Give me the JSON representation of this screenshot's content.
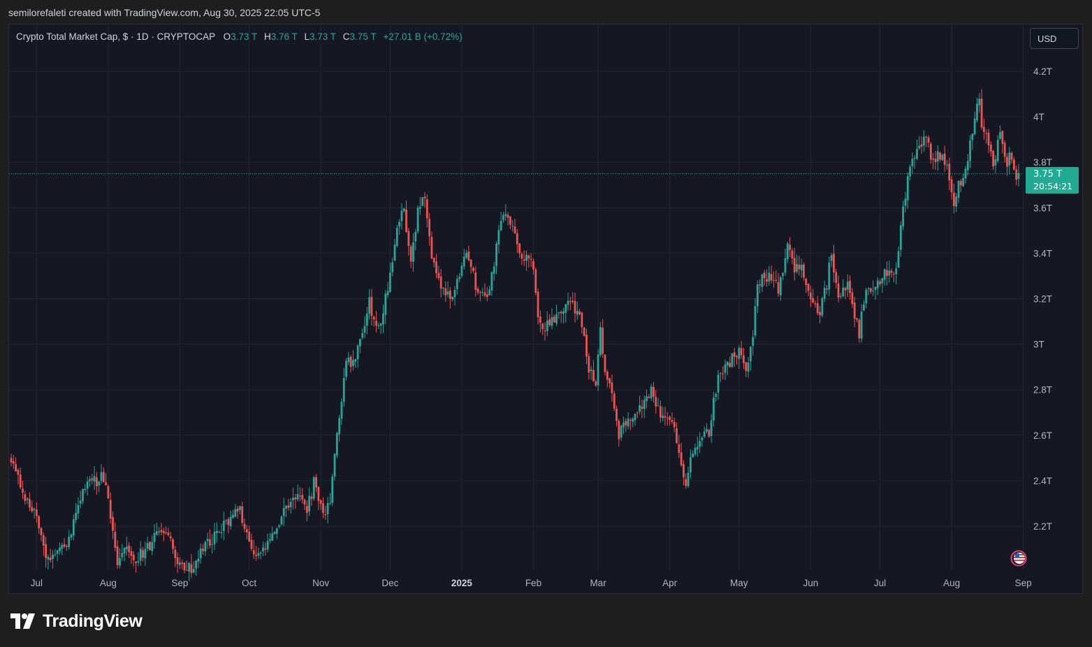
{
  "header": {
    "caption": "semilorefaleti created with TradingView.com, Aug 30, 2025 22:05 UTC-5"
  },
  "legend": {
    "symbol": "Crypto Total Market Cap, $ · 1D · CRYPTOCAP",
    "o_label": "O",
    "o_value": "3.73 T",
    "h_label": "H",
    "h_value": "3.76 T",
    "l_label": "L",
    "l_value": "3.73 T",
    "c_label": "C",
    "c_value": "3.75 T",
    "change": "+27.01 B (+0.72%)"
  },
  "currency_button": {
    "label": "USD"
  },
  "price_tag": {
    "price": "3.75 T",
    "countdown": "20:54:21"
  },
  "footer": {
    "brand": "TradingView",
    "logo_icon": "tradingview-logo-icon"
  },
  "colors": {
    "up": "#26a69a",
    "down": "#ef5350",
    "background": "#151823",
    "grid": "#22262f",
    "axis_text": "#b2b5be",
    "price_line": "#22ab94"
  },
  "chart_data": {
    "type": "candlestick",
    "title": "Crypto Total Market Cap, $ · 1D · CRYPTOCAP",
    "xlabel": "",
    "ylabel": "",
    "y_unit": "T USD",
    "ylim": [
      2.0,
      4.3
    ],
    "y_ticks": [
      {
        "value": 2.2,
        "label": "2.2T"
      },
      {
        "value": 2.4,
        "label": "2.4T"
      },
      {
        "value": 2.6,
        "label": "2.6T"
      },
      {
        "value": 2.8,
        "label": "2.8T"
      },
      {
        "value": 3.0,
        "label": "3T"
      },
      {
        "value": 3.2,
        "label": "3.2T"
      },
      {
        "value": 3.4,
        "label": "3.4T"
      },
      {
        "value": 3.6,
        "label": "3.6T"
      },
      {
        "value": 3.8,
        "label": "3.8T"
      },
      {
        "value": 4.0,
        "label": "4T"
      },
      {
        "value": 4.2,
        "label": "4.2T"
      }
    ],
    "x_range": [
      "2024-06-20",
      "2025-08-30"
    ],
    "x_ticks": [
      {
        "date": "2024-07-01",
        "label": "Jul",
        "bold": false
      },
      {
        "date": "2024-08-01",
        "label": "Aug",
        "bold": false
      },
      {
        "date": "2024-09-01",
        "label": "Sep",
        "bold": false
      },
      {
        "date": "2024-10-01",
        "label": "Oct",
        "bold": false
      },
      {
        "date": "2024-11-01",
        "label": "Nov",
        "bold": false
      },
      {
        "date": "2024-12-01",
        "label": "Dec",
        "bold": false
      },
      {
        "date": "2025-01-01",
        "label": "2025",
        "bold": true
      },
      {
        "date": "2025-02-01",
        "label": "Feb",
        "bold": false
      },
      {
        "date": "2025-03-01",
        "label": "Mar",
        "bold": false
      },
      {
        "date": "2025-04-01",
        "label": "Apr",
        "bold": false
      },
      {
        "date": "2025-05-01",
        "label": "May",
        "bold": false
      },
      {
        "date": "2025-06-01",
        "label": "Jun",
        "bold": false
      },
      {
        "date": "2025-07-01",
        "label": "Jul",
        "bold": false
      },
      {
        "date": "2025-08-01",
        "label": "Aug",
        "bold": false
      },
      {
        "date": "2025-09-01",
        "label": "Sep",
        "bold": false
      }
    ],
    "last_price": 3.75,
    "grid": true,
    "series": [
      {
        "name": "Crypto Total Market Cap",
        "close_path": [
          {
            "date": "2024-06-20",
            "close": 2.48
          },
          {
            "date": "2024-06-25",
            "close": 2.36
          },
          {
            "date": "2024-07-01",
            "close": 2.24
          },
          {
            "date": "2024-07-05",
            "close": 2.05
          },
          {
            "date": "2024-07-14",
            "close": 2.12
          },
          {
            "date": "2024-07-21",
            "close": 2.36
          },
          {
            "date": "2024-07-29",
            "close": 2.42
          },
          {
            "date": "2024-08-01",
            "close": 2.34
          },
          {
            "date": "2024-08-05",
            "close": 2.03
          },
          {
            "date": "2024-08-08",
            "close": 2.1
          },
          {
            "date": "2024-08-14",
            "close": 2.06
          },
          {
            "date": "2024-08-24",
            "close": 2.18
          },
          {
            "date": "2024-08-27",
            "close": 2.14
          },
          {
            "date": "2024-09-01",
            "close": 2.04
          },
          {
            "date": "2024-09-06",
            "close": 2.01
          },
          {
            "date": "2024-09-13",
            "close": 2.12
          },
          {
            "date": "2024-09-19",
            "close": 2.2
          },
          {
            "date": "2024-09-27",
            "close": 2.28
          },
          {
            "date": "2024-10-01",
            "close": 2.12
          },
          {
            "date": "2024-10-03",
            "close": 2.08
          },
          {
            "date": "2024-10-10",
            "close": 2.12
          },
          {
            "date": "2024-10-15",
            "close": 2.24
          },
          {
            "date": "2024-10-21",
            "close": 2.33
          },
          {
            "date": "2024-10-26",
            "close": 2.26
          },
          {
            "date": "2024-10-29",
            "close": 2.39
          },
          {
            "date": "2024-11-02",
            "close": 2.24
          },
          {
            "date": "2024-11-05",
            "close": 2.32
          },
          {
            "date": "2024-11-08",
            "close": 2.6
          },
          {
            "date": "2024-11-12",
            "close": 2.92
          },
          {
            "date": "2024-11-16",
            "close": 2.93
          },
          {
            "date": "2024-11-22",
            "close": 3.18
          },
          {
            "date": "2024-11-26",
            "close": 3.06
          },
          {
            "date": "2024-12-02",
            "close": 3.35
          },
          {
            "date": "2024-12-05",
            "close": 3.56
          },
          {
            "date": "2024-12-07",
            "close": 3.6
          },
          {
            "date": "2024-12-10",
            "close": 3.34
          },
          {
            "date": "2024-12-13",
            "close": 3.6
          },
          {
            "date": "2024-12-16",
            "close": 3.66
          },
          {
            "date": "2024-12-19",
            "close": 3.36
          },
          {
            "date": "2024-12-23",
            "close": 3.24
          },
          {
            "date": "2024-12-27",
            "close": 3.2
          },
          {
            "date": "2024-12-31",
            "close": 3.28
          },
          {
            "date": "2025-01-03",
            "close": 3.4
          },
          {
            "date": "2025-01-07",
            "close": 3.26
          },
          {
            "date": "2025-01-09",
            "close": 3.2
          },
          {
            "date": "2025-01-13",
            "close": 3.22
          },
          {
            "date": "2025-01-17",
            "close": 3.5
          },
          {
            "date": "2025-01-20",
            "close": 3.58
          },
          {
            "date": "2025-01-23",
            "close": 3.54
          },
          {
            "date": "2025-01-27",
            "close": 3.38
          },
          {
            "date": "2025-01-31",
            "close": 3.4
          },
          {
            "date": "2025-02-02",
            "close": 3.22
          },
          {
            "date": "2025-02-03",
            "close": 3.1
          },
          {
            "date": "2025-02-07",
            "close": 3.08
          },
          {
            "date": "2025-02-12",
            "close": 3.14
          },
          {
            "date": "2025-02-17",
            "close": 3.18
          },
          {
            "date": "2025-02-21",
            "close": 3.14
          },
          {
            "date": "2025-02-25",
            "close": 2.9
          },
          {
            "date": "2025-02-28",
            "close": 2.82
          },
          {
            "date": "2025-03-02",
            "close": 3.06
          },
          {
            "date": "2025-03-04",
            "close": 2.86
          },
          {
            "date": "2025-03-07",
            "close": 2.8
          },
          {
            "date": "2025-03-10",
            "close": 2.6
          },
          {
            "date": "2025-03-13",
            "close": 2.66
          },
          {
            "date": "2025-03-19",
            "close": 2.72
          },
          {
            "date": "2025-03-24",
            "close": 2.8
          },
          {
            "date": "2025-03-28",
            "close": 2.68
          },
          {
            "date": "2025-03-31",
            "close": 2.65
          },
          {
            "date": "2025-04-03",
            "close": 2.62
          },
          {
            "date": "2025-04-07",
            "close": 2.42
          },
          {
            "date": "2025-04-08",
            "close": 2.38
          },
          {
            "date": "2025-04-10",
            "close": 2.5
          },
          {
            "date": "2025-04-14",
            "close": 2.6
          },
          {
            "date": "2025-04-18",
            "close": 2.62
          },
          {
            "date": "2025-04-22",
            "close": 2.86
          },
          {
            "date": "2025-04-26",
            "close": 2.92
          },
          {
            "date": "2025-05-01",
            "close": 2.96
          },
          {
            "date": "2025-05-04",
            "close": 2.9
          },
          {
            "date": "2025-05-07",
            "close": 3.04
          },
          {
            "date": "2025-05-09",
            "close": 3.28
          },
          {
            "date": "2025-05-14",
            "close": 3.3
          },
          {
            "date": "2025-05-18",
            "close": 3.24
          },
          {
            "date": "2025-05-22",
            "close": 3.44
          },
          {
            "date": "2025-05-25",
            "close": 3.34
          },
          {
            "date": "2025-05-28",
            "close": 3.36
          },
          {
            "date": "2025-05-31",
            "close": 3.24
          },
          {
            "date": "2025-06-05",
            "close": 3.14
          },
          {
            "date": "2025-06-08",
            "close": 3.26
          },
          {
            "date": "2025-06-10",
            "close": 3.4
          },
          {
            "date": "2025-06-13",
            "close": 3.22
          },
          {
            "date": "2025-06-17",
            "close": 3.26
          },
          {
            "date": "2025-06-20",
            "close": 3.14
          },
          {
            "date": "2025-06-22",
            "close": 3.04
          },
          {
            "date": "2025-06-24",
            "close": 3.2
          },
          {
            "date": "2025-06-28",
            "close": 3.24
          },
          {
            "date": "2025-07-01",
            "close": 3.26
          },
          {
            "date": "2025-07-03",
            "close": 3.32
          },
          {
            "date": "2025-07-07",
            "close": 3.3
          },
          {
            "date": "2025-07-09",
            "close": 3.4
          },
          {
            "date": "2025-07-11",
            "close": 3.62
          },
          {
            "date": "2025-07-14",
            "close": 3.76
          },
          {
            "date": "2025-07-18",
            "close": 3.88
          },
          {
            "date": "2025-07-21",
            "close": 3.9
          },
          {
            "date": "2025-07-24",
            "close": 3.8
          },
          {
            "date": "2025-07-28",
            "close": 3.84
          },
          {
            "date": "2025-07-31",
            "close": 3.74
          },
          {
            "date": "2025-08-02",
            "close": 3.6
          },
          {
            "date": "2025-08-04",
            "close": 3.7
          },
          {
            "date": "2025-08-07",
            "close": 3.78
          },
          {
            "date": "2025-08-10",
            "close": 3.94
          },
          {
            "date": "2025-08-13",
            "close": 4.08
          },
          {
            "date": "2025-08-14",
            "close": 3.96
          },
          {
            "date": "2025-08-17",
            "close": 3.9
          },
          {
            "date": "2025-08-19",
            "close": 3.76
          },
          {
            "date": "2025-08-22",
            "close": 3.96
          },
          {
            "date": "2025-08-25",
            "close": 3.76
          },
          {
            "date": "2025-08-26",
            "close": 3.84
          },
          {
            "date": "2025-08-28",
            "close": 3.78
          },
          {
            "date": "2025-08-29",
            "close": 3.7
          },
          {
            "date": "2025-08-30",
            "close": 3.75
          }
        ]
      }
    ]
  }
}
